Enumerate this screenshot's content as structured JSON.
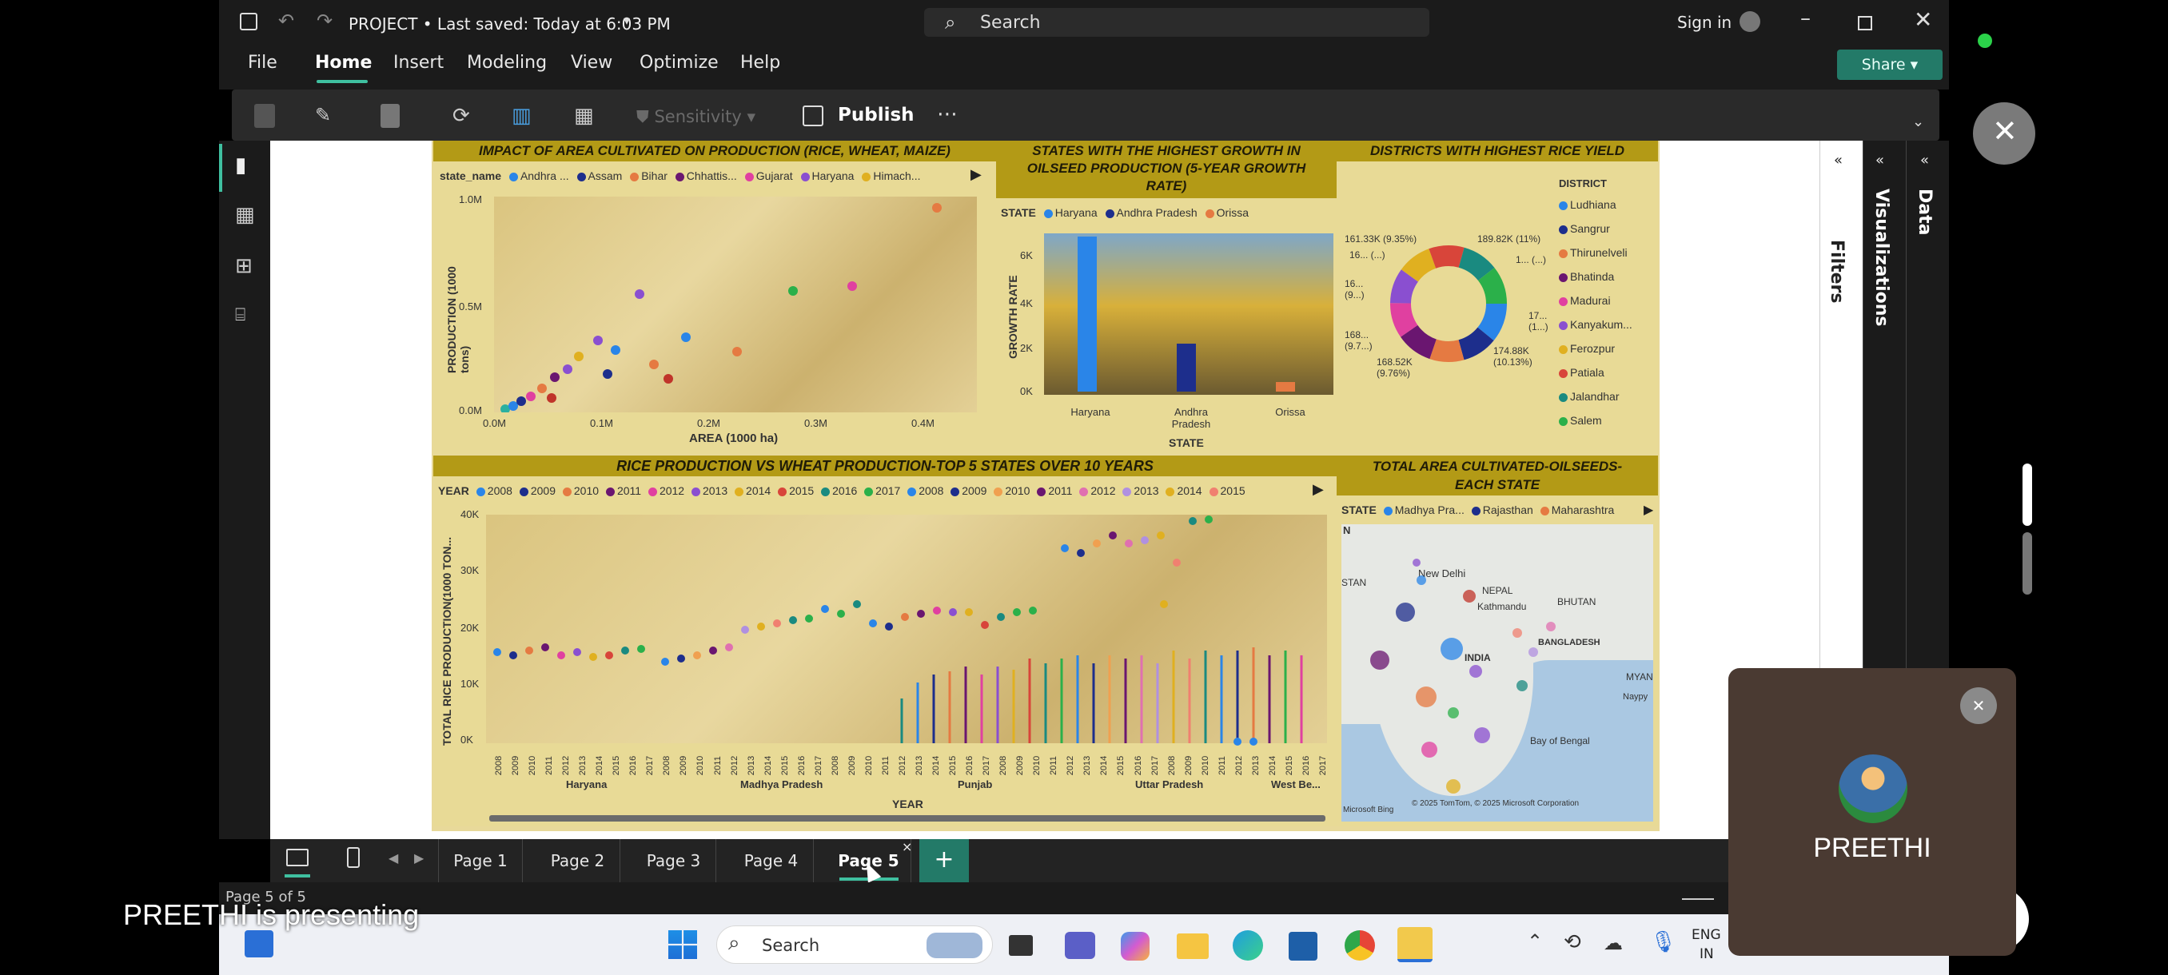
{
  "app": {
    "title": "PROJECT • Last saved: Today at 6:03 PM",
    "search": "Search",
    "sign_in": "Sign in",
    "share": "Share"
  },
  "menu": [
    "File",
    "Home",
    "Insert",
    "Modeling",
    "View",
    "Optimize",
    "Help"
  ],
  "ribbon": {
    "sensitivity": "Sensitivity",
    "publish": "Publish"
  },
  "side": {
    "filters": "Filters",
    "visualizations": "Visualizations",
    "data": "Data"
  },
  "chart1": {
    "title": "IMPACT OF AREA CULTIVATED ON PRODUCTION (RICE, WHEAT, MAIZE)",
    "legend_title": "state_name",
    "legend": [
      "Andhra ...",
      "Assam",
      "Bihar",
      "Chhattis...",
      "Gujarat",
      "Haryana",
      "Himach..."
    ],
    "ylabel": "PRODUCTION (1000 tons)",
    "xlabel": "AREA (1000 ha)",
    "yticks": [
      "1.0M",
      "0.5M",
      "0.0M"
    ],
    "xticks": [
      "0.0M",
      "0.1M",
      "0.2M",
      "0.3M",
      "0.4M"
    ]
  },
  "chart2": {
    "title": "STATES WITH THE HIGHEST GROWTH IN OILSEED PRODUCTION (5-YEAR GROWTH RATE)",
    "legend_title": "STATE",
    "legend": [
      "Haryana",
      "Andhra Pradesh",
      "Orissa"
    ],
    "ylabel": "GROWTH RATE",
    "xlabel": "STATE",
    "yticks": [
      "6K",
      "4K",
      "2K",
      "0K"
    ],
    "categories": [
      "Haryana",
      "Andhra Pradesh",
      "Orissa"
    ]
  },
  "chart3": {
    "title": "DISTRICTS WITH HIGHEST RICE YIELD",
    "legend_title": "DISTRICT",
    "legend": [
      "Ludhiana",
      "Sangrur",
      "Thirunelveli",
      "Bhatinda",
      "Madurai",
      "Kanyakum...",
      "Ferozpur",
      "Patiala",
      "Jalandhar",
      "Salem"
    ],
    "labels": [
      "161.33K (9.35%)",
      "189.82K (11%)",
      "16... (...)",
      "1... (...)",
      "16... (9...)",
      "17... (1...)",
      "168... (9.7...)",
      "174.88K (10.13%)",
      "168.52K (9.76%)"
    ]
  },
  "chart4": {
    "title": "RICE PRODUCTION VS WHEAT PRODUCTION-TOP 5 STATES OVER 10 YEARS",
    "legend_title": "YEAR",
    "legend": [
      "2008",
      "2009",
      "2010",
      "2011",
      "2012",
      "2013",
      "2014",
      "2015",
      "2016",
      "2017",
      "2008",
      "2009",
      "2010",
      "2011",
      "2012",
      "2013",
      "2014",
      "2015"
    ],
    "ylabel": "TOTAL RICE PRODUCTION(1000 TON...",
    "xlabel": "YEAR",
    "yticks": [
      "40K",
      "30K",
      "20K",
      "10K",
      "0K"
    ],
    "groups": [
      "Haryana",
      "Madhya Pradesh",
      "Punjab",
      "Uttar Pradesh",
      "West Be..."
    ],
    "xyears": [
      "2008",
      "2009",
      "2010",
      "2011",
      "2012",
      "2013",
      "2014",
      "2015",
      "2016",
      "2017"
    ]
  },
  "chart5": {
    "title": "TOTAL AREA CULTIVATED-OILSEEDS-EACH STATE",
    "legend_title": "STATE",
    "legend": [
      "Madhya Pra...",
      "Rajasthan",
      "Maharashtra"
    ],
    "map_labels": [
      "New Delhi",
      "NEPAL",
      "Kathmandu",
      "BHUTAN",
      "INDIA",
      "BANGLADESH",
      "MYAN",
      "Naypy",
      "Bay of Bengal",
      "STAN",
      "N"
    ],
    "credit": "© 2025 TomTom, © 2025 Microsoft Corporation",
    "bing": "Microsoft Bing"
  },
  "pages": [
    "Page 1",
    "Page 2",
    "Page 3",
    "Page 4",
    "Page 5"
  ],
  "status": "Page 5 of 5",
  "presenter": {
    "name": "PREETHI",
    "banner": "PREETHI is presenting"
  },
  "taskbar": {
    "search": "Search",
    "lang": "ENG",
    "region": "IN"
  }
}
